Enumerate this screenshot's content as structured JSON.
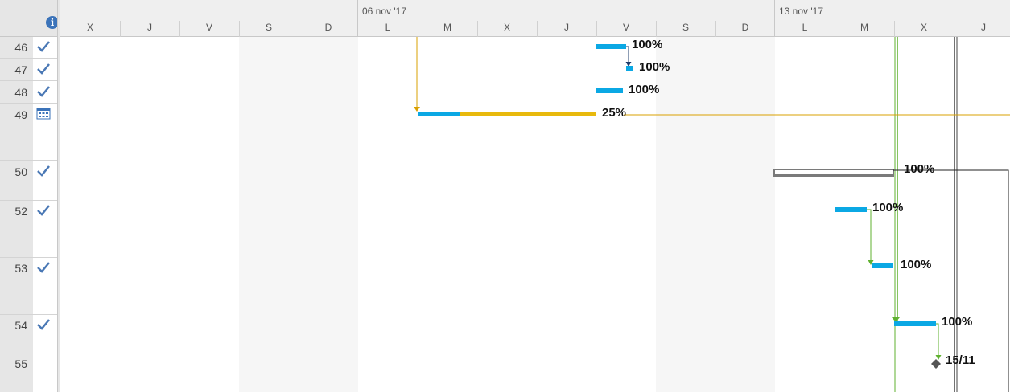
{
  "header": {
    "info_icon": "info-icon",
    "weeks": [
      "06 nov '17",
      "13 nov '17"
    ],
    "days": [
      "X",
      "J",
      "V",
      "S",
      "D",
      "L",
      "M",
      "X",
      "J",
      "V",
      "S",
      "D",
      "L",
      "M",
      "X",
      "J"
    ]
  },
  "rows": [
    {
      "id": "46",
      "indicator": "check-icon"
    },
    {
      "id": "47",
      "indicator": "check-icon"
    },
    {
      "id": "48",
      "indicator": "check-icon"
    },
    {
      "id": "49",
      "indicator": "calendar-icon"
    },
    {
      "id": "50",
      "indicator": "check-icon"
    },
    {
      "id": "52",
      "indicator": "check-icon"
    },
    {
      "id": "53",
      "indicator": "check-icon"
    },
    {
      "id": "54",
      "indicator": "check-icon"
    },
    {
      "id": "55",
      "indicator": ""
    }
  ],
  "labels": {
    "t46": "100%",
    "t47": "100%",
    "t48": "100%",
    "t49": "25%",
    "t50": "100%",
    "t52": "100%",
    "t53": "100%",
    "t54": "100%",
    "t55": "15/11"
  },
  "colors": {
    "task_bar": "#0ba8e4",
    "remaining_bar": "#e8b90d",
    "summary_bar": "#7a7a7a",
    "link_green": "#5fb12f",
    "link_orange": "#d9a000",
    "link_dark": "#1f3d6b"
  }
}
